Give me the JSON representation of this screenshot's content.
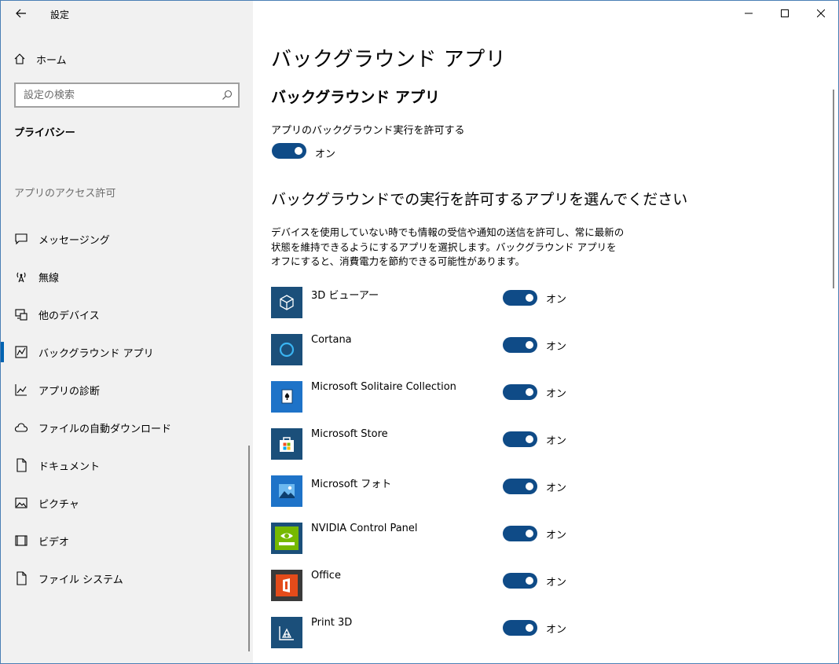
{
  "window": {
    "title": "設定",
    "controls": [
      "minimize",
      "maximize",
      "close"
    ]
  },
  "sidebar": {
    "home_label": "ホーム",
    "search_placeholder": "設定の検索",
    "section_title": "プライバシー",
    "group_label": "アプリのアクセス許可",
    "items": [
      {
        "label": "メッセージング",
        "icon": "message-icon",
        "active": false
      },
      {
        "label": "無線",
        "icon": "radio-icon",
        "active": false
      },
      {
        "label": "他のデバイス",
        "icon": "devices-icon",
        "active": false
      },
      {
        "label": "バックグラウンド アプリ",
        "icon": "background-apps-icon",
        "active": true
      },
      {
        "label": "アプリの診断",
        "icon": "diagnostics-icon",
        "active": false
      },
      {
        "label": "ファイルの自動ダウンロード",
        "icon": "cloud-icon",
        "active": false
      },
      {
        "label": "ドキュメント",
        "icon": "document-icon",
        "active": false
      },
      {
        "label": "ピクチャ",
        "icon": "picture-icon",
        "active": false
      },
      {
        "label": "ビデオ",
        "icon": "video-icon",
        "active": false
      },
      {
        "label": "ファイル システム",
        "icon": "file-icon",
        "active": false
      }
    ]
  },
  "main": {
    "page_title": "バックグラウンド アプリ",
    "section_title": "バックグラウンド アプリ",
    "allow_label": "アプリのバックグラウンド実行を許可する",
    "allow_state": "オン",
    "choose_title": "バックグラウンドでの実行を許可するアプリを選んでください",
    "description": "デバイスを使用していない時でも情報の受信や通知の送信を許可し、常に最新の状態を維持できるようにするアプリを選択します。バックグラウンド アプリをオフにすると、消費電力を節約できる可能性があります。",
    "apps": [
      {
        "name": "3D ビューアー",
        "state": "オン",
        "tile_color": "#1b4f7a",
        "icon": "cube-icon"
      },
      {
        "name": "Cortana",
        "state": "オン",
        "tile_color": "#1b4f7a",
        "icon": "cortana-icon"
      },
      {
        "name": "Microsoft Solitaire Collection",
        "state": "オン",
        "tile_color": "#1e73c8",
        "icon": "solitaire-icon"
      },
      {
        "name": "Microsoft Store",
        "state": "オン",
        "tile_color": "#1b4f7a",
        "icon": "store-icon"
      },
      {
        "name": "Microsoft フォト",
        "state": "オン",
        "tile_color": "#1e73c8",
        "icon": "photos-icon"
      },
      {
        "name": "NVIDIA Control Panel",
        "state": "オン",
        "tile_color": "#76b900",
        "icon": "nvidia-icon"
      },
      {
        "name": "Office",
        "state": "オン",
        "tile_color": "#3a3a3a",
        "icon": "office-icon"
      },
      {
        "name": "Print 3D",
        "state": "オン",
        "tile_color": "#1b4f7a",
        "icon": "print3d-icon"
      }
    ]
  }
}
